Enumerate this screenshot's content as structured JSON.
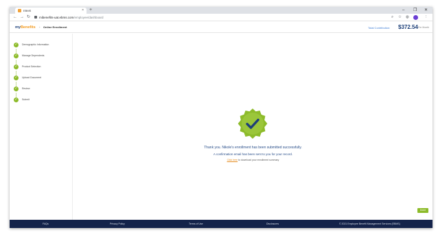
{
  "browser": {
    "tab_title": "EBMS",
    "new_tab_icon": "plus-icon",
    "url_host": "mibenefits-uat.ebms.com",
    "url_path": "/employee/dashboard"
  },
  "header": {
    "logo_my": "my",
    "logo_benefits": "Benefits",
    "breadcrumb": "Online Enrollment",
    "total_label": "Total Contribution:",
    "total_amount": "$372.54",
    "total_period": "Per Month"
  },
  "sidebar": {
    "steps": [
      {
        "label": "Demographic Information",
        "status": "complete"
      },
      {
        "label": "Manage Dependents",
        "status": "complete"
      },
      {
        "label": "Product Selection",
        "status": "complete"
      },
      {
        "label": "Upload Document",
        "status": "complete"
      },
      {
        "label": "Review",
        "status": "complete"
      },
      {
        "label": "Submit",
        "status": "complete"
      }
    ]
  },
  "main": {
    "badge_icon": "checkmark-badge-icon",
    "message_primary": "Thank you. Nikole's enrollment has been submitted successfully.",
    "message_secondary": "A confirmation email has been sent to you for your record.",
    "summary_link": "Click here",
    "summary_text": " to download your enrollment summary",
    "done_button": "Done"
  },
  "footer": {
    "links": [
      "FAQs",
      "Privacy Policy",
      "Terms of Use",
      "Disclosures",
      "© 2021 Employee Benefit Management Services (EBMS)"
    ]
  },
  "colors": {
    "accent_green": "#8dbb2a",
    "navy": "#14234a",
    "brand_orange": "#f29a1f"
  }
}
